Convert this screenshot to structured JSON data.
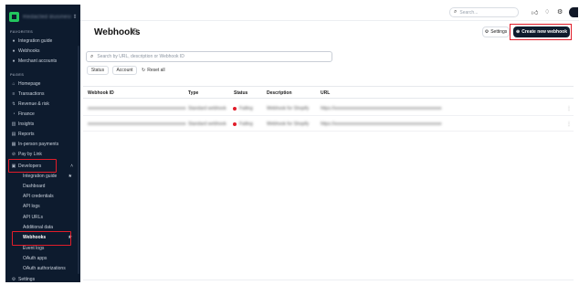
{
  "org": {
    "name": "Redacted Business",
    "chevron": "⇕"
  },
  "sidebar": {
    "section_favorites": "FAVORITES",
    "favorites": [
      {
        "label": "Integration guide",
        "icon": "bullet-icon"
      },
      {
        "label": "Webhooks",
        "icon": "bullet-icon"
      },
      {
        "label": "Merchant accounts",
        "icon": "bullet-icon"
      }
    ],
    "section_pages": "PAGES",
    "pages": [
      {
        "label": "Homepage",
        "glyph": "⌂"
      },
      {
        "label": "Transactions",
        "glyph": "≡"
      },
      {
        "label": "Revenue & risk",
        "glyph": "↯"
      },
      {
        "label": "Finance",
        "glyph": "◔"
      },
      {
        "label": "Insights",
        "glyph": "▥"
      },
      {
        "label": "Reports",
        "glyph": "▤"
      },
      {
        "label": "In-person payments",
        "glyph": "▦"
      },
      {
        "label": "Pay by Link",
        "glyph": "⊘"
      }
    ],
    "developers": {
      "label": "Developers",
      "glyph": "▣",
      "chevron": "˄"
    },
    "dev_items": [
      "Integration guide",
      "Dashboard",
      "API credentials",
      "API logs",
      "API URLs",
      "Additional data",
      "Webhooks",
      "Event logs",
      "OAuth apps",
      "OAuth authorizations"
    ],
    "settings": "Settings"
  },
  "topbar": {
    "search_placeholder": "Search..."
  },
  "page": {
    "title": "Webhooks",
    "info_glyph": "i",
    "settings_label": "Settings",
    "create_label": "Create new webhook",
    "search_placeholder": "Search by URL, description or Webhook ID",
    "filters": [
      "Status",
      "Account"
    ],
    "reset_label": "Reset all"
  },
  "table": {
    "headers": [
      "Webhook ID",
      "Type",
      "Status",
      "Description",
      "URL"
    ],
    "rows": [
      {
        "id": "xxxxxxxxxxxxxxxxxxxxxxxxxxxxxxxxxxxxxxxxxxx",
        "type": "Standard webhook",
        "status": "Failing",
        "description": "Webhook for Shopify",
        "url": "https://xxxxxxxxxxxxxxxxxxxxxxxxxxxxxxxxxxxxxxxxxxxxxxx"
      },
      {
        "id": "xxxxxxxxxxxxxxxxxxxxxxxxxxxxxxxxxxxxxxxxxxx",
        "type": "Standard webhook",
        "status": "Failing",
        "description": "Webhook for Shopify",
        "url": "https://xxxxxxxxxxxxxxxxxxxxxxxxxxxxxxxxxxxxxxxxxxxxxxx"
      }
    ]
  },
  "colors": {
    "sidebar_bg": "#0d1b2e",
    "primary_btn": "#0f1b2d",
    "highlight": "#e11d2a",
    "status_failing": "#e11d2a",
    "logo": "#22c55e"
  }
}
